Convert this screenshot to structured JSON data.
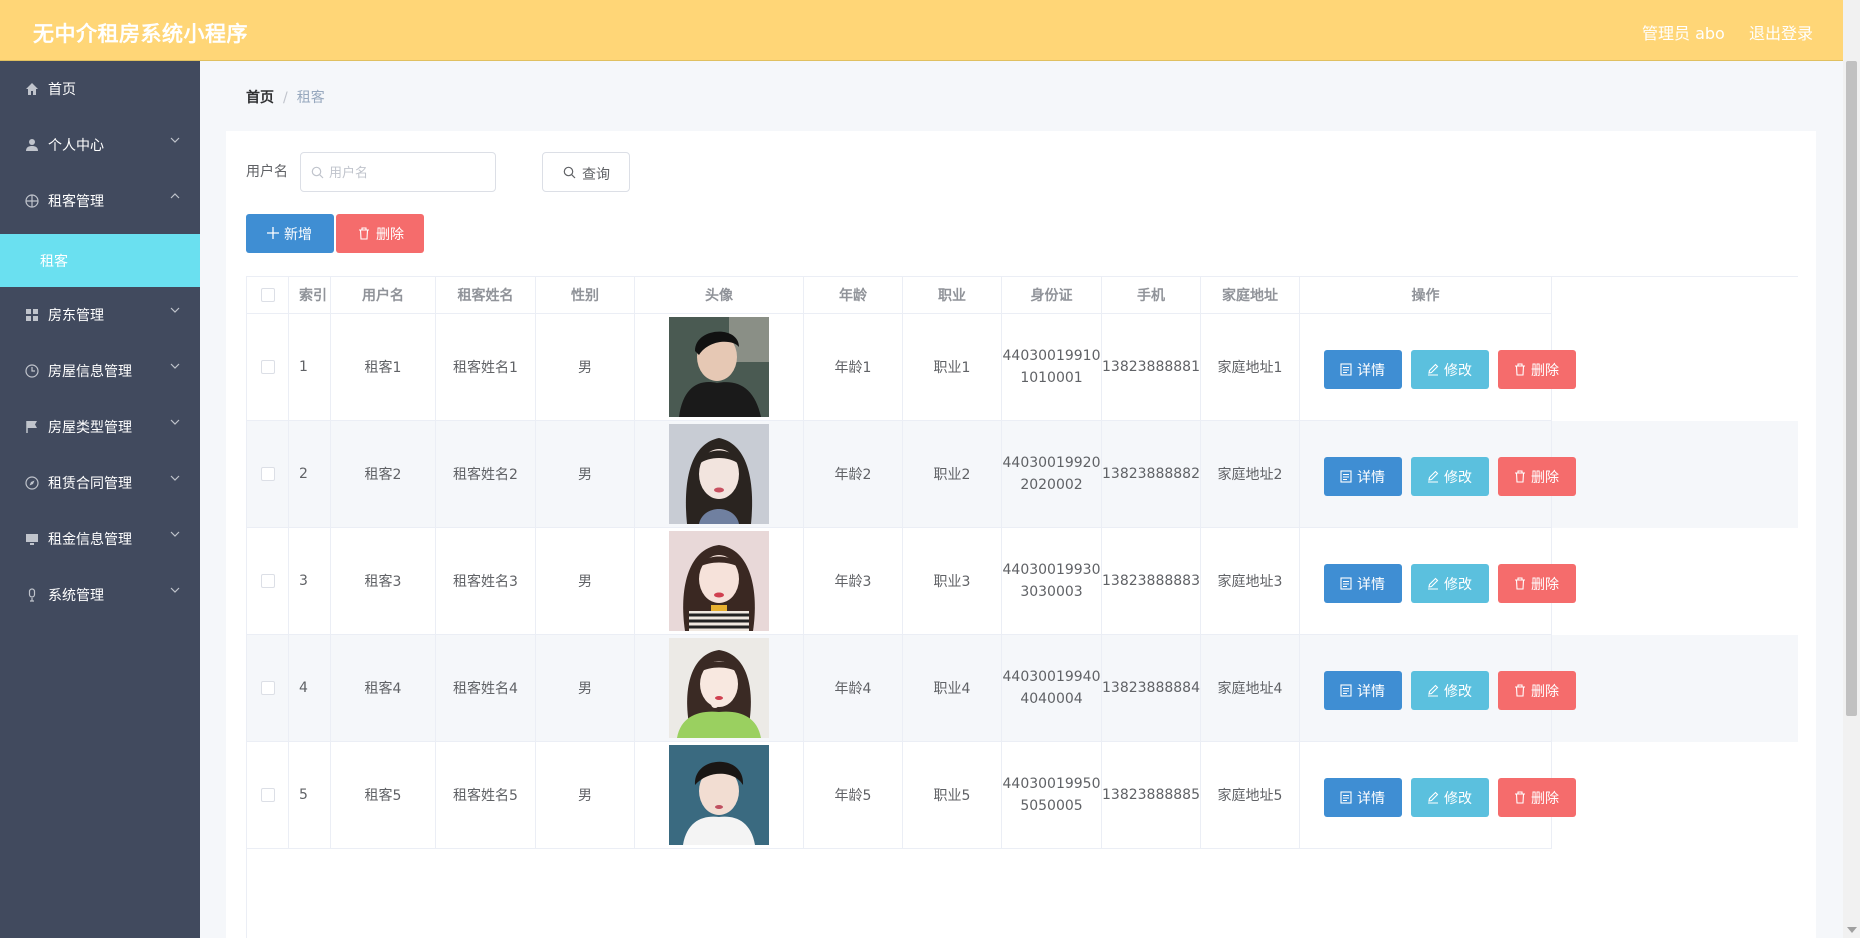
{
  "header": {
    "title": "无中介租房系统小程序",
    "user": "管理员 abo",
    "logout": "退出登录"
  },
  "sidebar": {
    "items": [
      {
        "label": "首页",
        "icon": "home-icon"
      },
      {
        "label": "个人中心",
        "icon": "user-icon"
      },
      {
        "label": "租客管理",
        "icon": "target-icon"
      },
      {
        "label": "房东管理",
        "icon": "grid-icon"
      },
      {
        "label": "房屋信息管理",
        "icon": "clock-icon"
      },
      {
        "label": "房屋类型管理",
        "icon": "flag-icon"
      },
      {
        "label": "租赁合同管理",
        "icon": "compass-icon"
      },
      {
        "label": "租金信息管理",
        "icon": "monitor-icon"
      },
      {
        "label": "系统管理",
        "icon": "microphone-icon"
      }
    ],
    "active_sub": "租客"
  },
  "breadcrumb": {
    "home": "首页",
    "sep": "/",
    "current": "租客"
  },
  "search": {
    "label": "用户名",
    "placeholder": "用户名",
    "button": "查询"
  },
  "actions": {
    "add": "新增",
    "delete": "删除"
  },
  "table": {
    "headers": [
      "索引",
      "用户名",
      "租客姓名",
      "性别",
      "头像",
      "年龄",
      "职业",
      "身份证",
      "手机",
      "家庭地址",
      "操作"
    ],
    "rows": [
      {
        "index": "1",
        "username": "租客1",
        "name": "租客姓名1",
        "gender": "男",
        "age": "年龄1",
        "job": "职业1",
        "id_card": "44030019910\n1010001",
        "phone": "13823888881",
        "address": "家庭地址1"
      },
      {
        "index": "2",
        "username": "租客2",
        "name": "租客姓名2",
        "gender": "男",
        "age": "年龄2",
        "job": "职业2",
        "id_card": "44030019920\n2020002",
        "phone": "13823888882",
        "address": "家庭地址2"
      },
      {
        "index": "3",
        "username": "租客3",
        "name": "租客姓名3",
        "gender": "男",
        "age": "年龄3",
        "job": "职业3",
        "id_card": "44030019930\n3030003",
        "phone": "13823888883",
        "address": "家庭地址3"
      },
      {
        "index": "4",
        "username": "租客4",
        "name": "租客姓名4",
        "gender": "男",
        "age": "年龄4",
        "job": "职业4",
        "id_card": "44030019940\n4040004",
        "phone": "13823888884",
        "address": "家庭地址4"
      },
      {
        "index": "5",
        "username": "租客5",
        "name": "租客姓名5",
        "gender": "男",
        "age": "年龄5",
        "job": "职业5",
        "id_card": "44030019950\n5050005",
        "phone": "13823888885",
        "address": "家庭地址5"
      }
    ],
    "op_labels": {
      "detail": "详情",
      "edit": "修改",
      "delete": "删除"
    }
  },
  "colors": {
    "header_bg": "#ffd677",
    "sidebar_bg": "#414a5e",
    "sub_active": "#6ae0f0",
    "primary": "#3f8ed3",
    "info": "#5bc0de",
    "danger": "#f56c6c"
  }
}
